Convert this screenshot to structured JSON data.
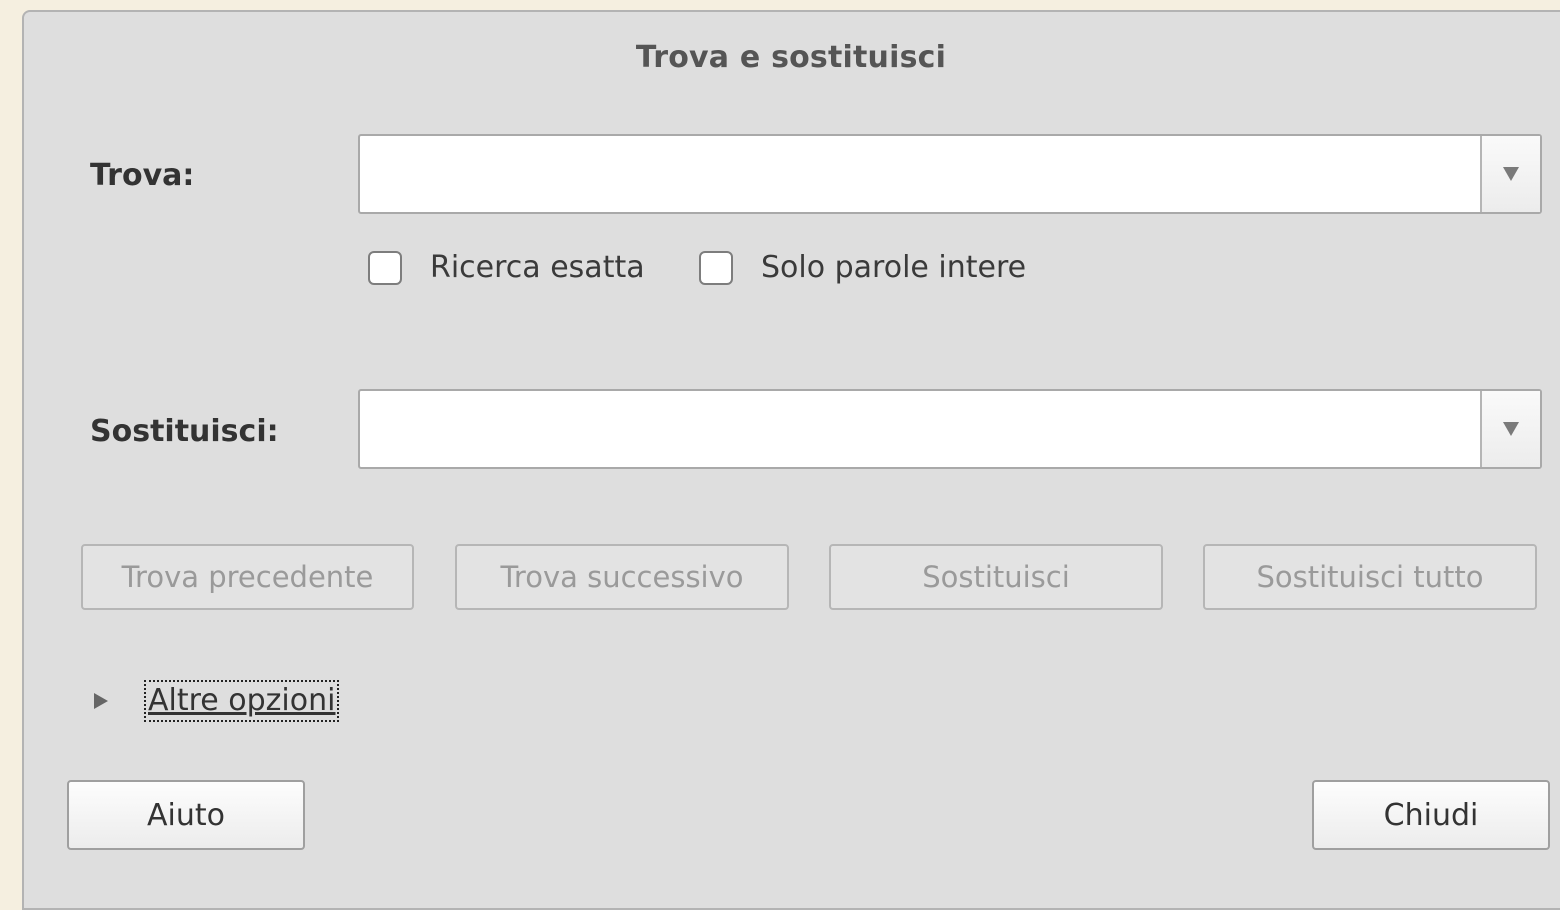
{
  "dialog": {
    "title": "Trova e sostituisci"
  },
  "find": {
    "label": "Trova:",
    "value": "",
    "dropdown_icon": "triangle-down-icon"
  },
  "options": {
    "match_case_label": "Ricerca esatta",
    "match_case_checked": false,
    "whole_words_label": "Solo parole intere",
    "whole_words_checked": false
  },
  "replace": {
    "label": "Sostituisci:",
    "value": "",
    "dropdown_icon": "triangle-down-icon"
  },
  "actions": {
    "find_previous": "Trova precedente",
    "find_next": "Trova successivo",
    "replace": "Sostituisci",
    "replace_all": "Sostituisci tutto"
  },
  "more_options": {
    "label": "Altre opzioni",
    "expanded": false,
    "icon": "triangle-right-icon"
  },
  "footer": {
    "help": "Aiuto",
    "close": "Chiudi"
  },
  "colors": {
    "dialog_bg": "#dedede",
    "disabled_text": "#9a9a9a"
  }
}
